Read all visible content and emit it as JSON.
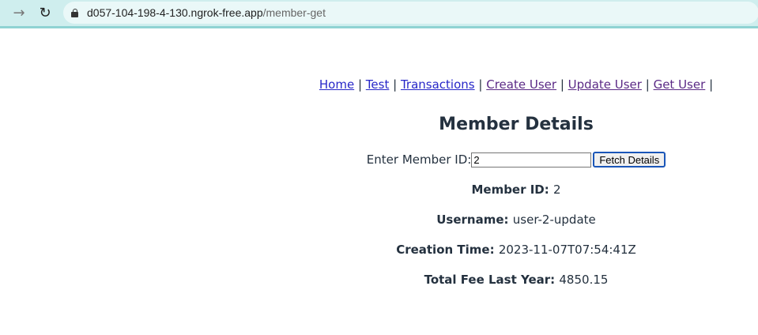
{
  "browser": {
    "url_host": "d057-104-198-4-130.ngrok-free.app",
    "url_path": "/member-get"
  },
  "nav": {
    "links": [
      "Home",
      "Test",
      "Transactions",
      "Create User",
      "Update User",
      "Get User"
    ],
    "separator": "|"
  },
  "page": {
    "title": "Member Details"
  },
  "form": {
    "label": "Enter Member ID:",
    "input_value": "2",
    "button_label": "Fetch Details"
  },
  "details": {
    "member_id_label": "Member ID:",
    "member_id_value": "2",
    "username_label": "Username:",
    "username_value": "user-2-update",
    "creation_time_label": "Creation Time:",
    "creation_time_value": "2023-11-07T07:54:41Z",
    "total_fee_label": "Total Fee Last Year:",
    "total_fee_value": "4850.15"
  }
}
